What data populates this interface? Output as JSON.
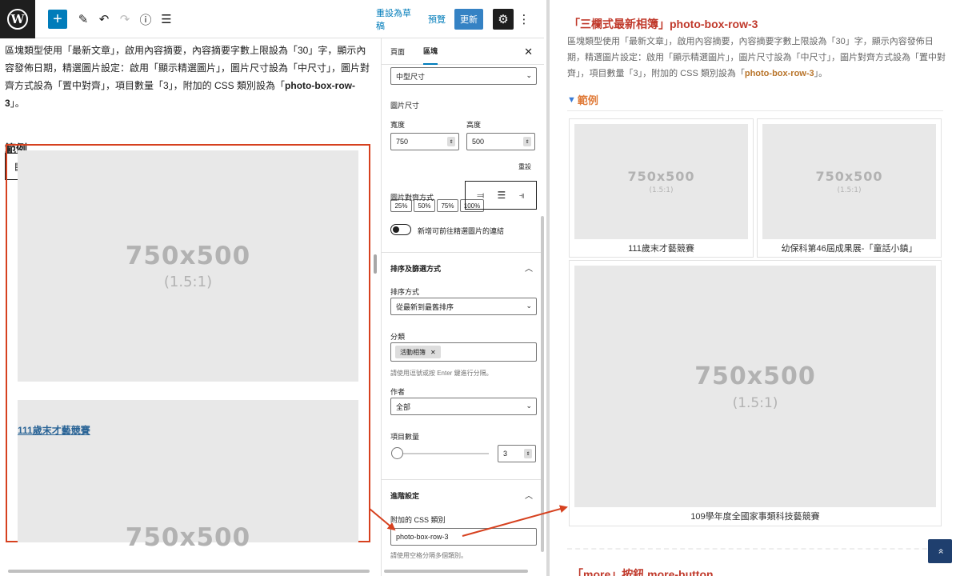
{
  "topbar": {
    "logo": "W",
    "add_icon": "+",
    "save_draft": "重設為草稿",
    "preview": "預覽",
    "update": "更新"
  },
  "editor": {
    "intro_before": "區塊類型使用「最新文章」，啟用內容摘要，內容摘要字數上限設為「30」字，顯示內容發佈日期，精選圖片設定：啟用「顯示精選圖片」，圖片尺寸設為「中尺寸」，圖片對齊方式設為「置中對齊」，項目數量「3」，附加的 CSS 類別設為「",
    "intro_class": "photo-box-row-3",
    "intro_after": "」。",
    "heading": "範例",
    "placeholder_size": "750x500",
    "placeholder_ratio": "(1.5:1)",
    "post1_title": "111歲末才藝競賽"
  },
  "sidebar": {
    "tab_page": "頁面",
    "tab_block": "區塊",
    "image_size_select": "中型尺寸",
    "image_dimensions_label": "圖片尺寸",
    "width_label": "寬度",
    "height_label": "高度",
    "width_value": "750",
    "height_value": "500",
    "pct_buttons": [
      "25%",
      "50%",
      "75%",
      "100%"
    ],
    "reset": "重設",
    "image_align_label": "圖片對齊方式",
    "link_toggle_label": "新增可前往精選圖片的連結",
    "sorting_section": "排序及篩選方式",
    "order_label": "排序方式",
    "order_value": "從最新到最舊排序",
    "category_label": "分類",
    "category_token": "活動相簿",
    "category_help": "請使用逗號或按 Enter 鍵進行分隔。",
    "author_label": "作者",
    "author_value": "全部",
    "count_label": "項目數量",
    "count_value": "3",
    "advanced_section": "進階設定",
    "css_class_label": "附加的 CSS 類別",
    "css_class_value": "photo-box-row-3",
    "css_class_help": "請使用空格分隔多個類別。"
  },
  "frontend": {
    "title": "「三欄式最新相簿」photo-box-row-3",
    "desc_before": "區塊類型使用「最新文章」，啟用內容摘要，內容摘要字數上限設為「30」字，顯示內容發佈日期，精選圖片設定：啟用「顯示精選圖片」，圖片尺寸設為「中尺寸」，圖片對齊方式設為「置中對齊」，項目數量「3」，附加的 CSS 類別設為「",
    "desc_class": "photo-box-row-3",
    "desc_after": "」。",
    "example_heading": "範例",
    "placeholder_size": "750x500",
    "placeholder_ratio": "(1.5:1)",
    "cards": [
      {
        "caption": "111歲末才藝競賽"
      },
      {
        "caption": "幼保科第46屆成果展-「童話小鎮」"
      },
      {
        "caption": "109學年度全國家事類科技藝競賽"
      }
    ],
    "next_heading": "「more」按鈕 more-button",
    "back_to_top_icon": "»"
  },
  "colors": {
    "accent_blue": "#007cba",
    "highlight_red": "#d6411f",
    "title_red": "#c0392b",
    "class_orange": "#b8742a"
  }
}
